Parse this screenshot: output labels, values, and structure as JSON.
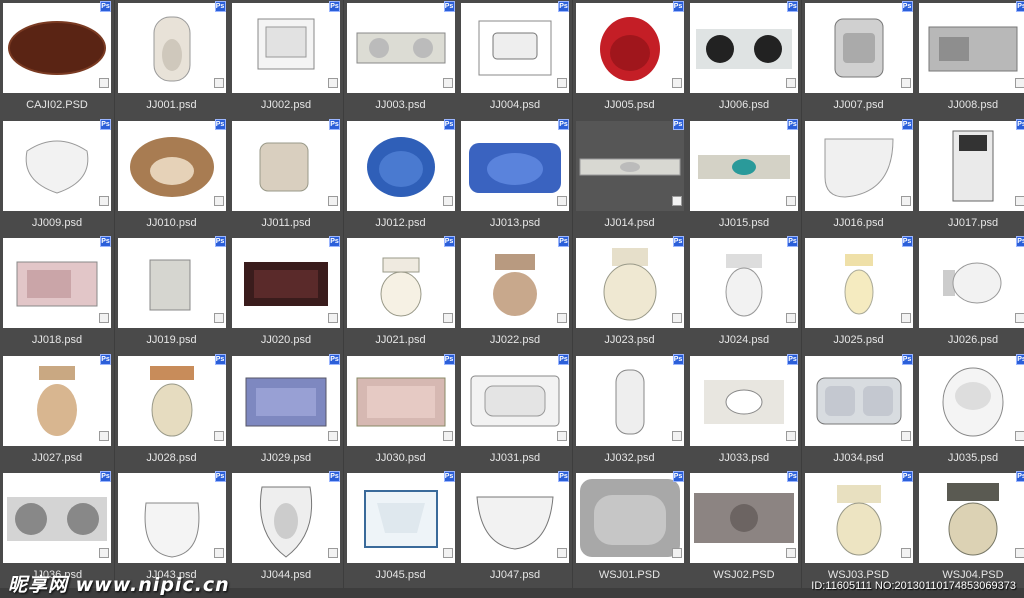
{
  "files": [
    {
      "name": "CAJI02.PSD",
      "icon": "wood-board"
    },
    {
      "name": "JJ001.psd",
      "icon": "bidet"
    },
    {
      "name": "JJ002.psd",
      "icon": "square-sink"
    },
    {
      "name": "JJ003.psd",
      "icon": "double-bowl-counter"
    },
    {
      "name": "JJ004.psd",
      "icon": "vanity-sink"
    },
    {
      "name": "JJ005.psd",
      "icon": "red-basin"
    },
    {
      "name": "JJ006.psd",
      "icon": "double-black-bowls"
    },
    {
      "name": "JJ007.psd",
      "icon": "gray-sink"
    },
    {
      "name": "JJ008.psd",
      "icon": "gray-counter-sink"
    },
    {
      "name": "JJ009.psd",
      "icon": "shell-basin"
    },
    {
      "name": "JJ010.psd",
      "icon": "marble-basin"
    },
    {
      "name": "JJ011.psd",
      "icon": "beige-sink"
    },
    {
      "name": "JJ012.psd",
      "icon": "blue-oval-basin"
    },
    {
      "name": "JJ013.psd",
      "icon": "blue-vanity"
    },
    {
      "name": "JJ014.psd",
      "icon": "long-counter"
    },
    {
      "name": "JJ015.psd",
      "icon": "teal-bowl-counter"
    },
    {
      "name": "JJ016.psd",
      "icon": "corner-tub"
    },
    {
      "name": "JJ017.psd",
      "icon": "shower-tray"
    },
    {
      "name": "JJ018.psd",
      "icon": "pink-tub"
    },
    {
      "name": "JJ019.psd",
      "icon": "gray-panel"
    },
    {
      "name": "JJ020.psd",
      "icon": "dark-tub"
    },
    {
      "name": "JJ021.psd",
      "icon": "ivory-toilet"
    },
    {
      "name": "JJ022.psd",
      "icon": "brown-toilet"
    },
    {
      "name": "JJ023.psd",
      "icon": "cream-toilet"
    },
    {
      "name": "JJ024.psd",
      "icon": "white-toilet"
    },
    {
      "name": "JJ025.psd",
      "icon": "yellow-toilet"
    },
    {
      "name": "JJ026.psd",
      "icon": "round-toilet"
    },
    {
      "name": "JJ027.psd",
      "icon": "tan-toilet"
    },
    {
      "name": "JJ028.psd",
      "icon": "cream-tan-toilet"
    },
    {
      "name": "JJ029.psd",
      "icon": "blue-tub"
    },
    {
      "name": "JJ030.psd",
      "icon": "rose-tub"
    },
    {
      "name": "JJ031.psd",
      "icon": "white-tub"
    },
    {
      "name": "JJ032.psd",
      "icon": "narrow-tub"
    },
    {
      "name": "JJ033.psd",
      "icon": "oval-sink-counter"
    },
    {
      "name": "JJ034.psd",
      "icon": "kitchen-double-sink"
    },
    {
      "name": "JJ035.psd",
      "icon": "round-urinal"
    },
    {
      "name": "JJ036.psd",
      "icon": "double-steel-bowls"
    },
    {
      "name": "JJ043.psd",
      "icon": "white-urinal"
    },
    {
      "name": "JJ044.psd",
      "icon": "squat-toilet"
    },
    {
      "name": "JJ045.psd",
      "icon": "blue-rim-sink"
    },
    {
      "name": "JJ047.psd",
      "icon": "wall-basin"
    },
    {
      "name": "WSJ01.PSD",
      "icon": "gray-basin"
    },
    {
      "name": "WSJ02.PSD",
      "icon": "stone-counter"
    },
    {
      "name": "WSJ03.PSD",
      "icon": "cream-toilet-2"
    },
    {
      "name": "WSJ04.PSD",
      "icon": "beige-toilet-2"
    }
  ],
  "watermark": "昵享网 www.nipic.cn",
  "id_text": "ID:11605111 NO:20130110174853069373",
  "colors": {
    "background": "#3d3d3d",
    "cell": "#4a4a4a",
    "badge": "#2b5fd9"
  }
}
